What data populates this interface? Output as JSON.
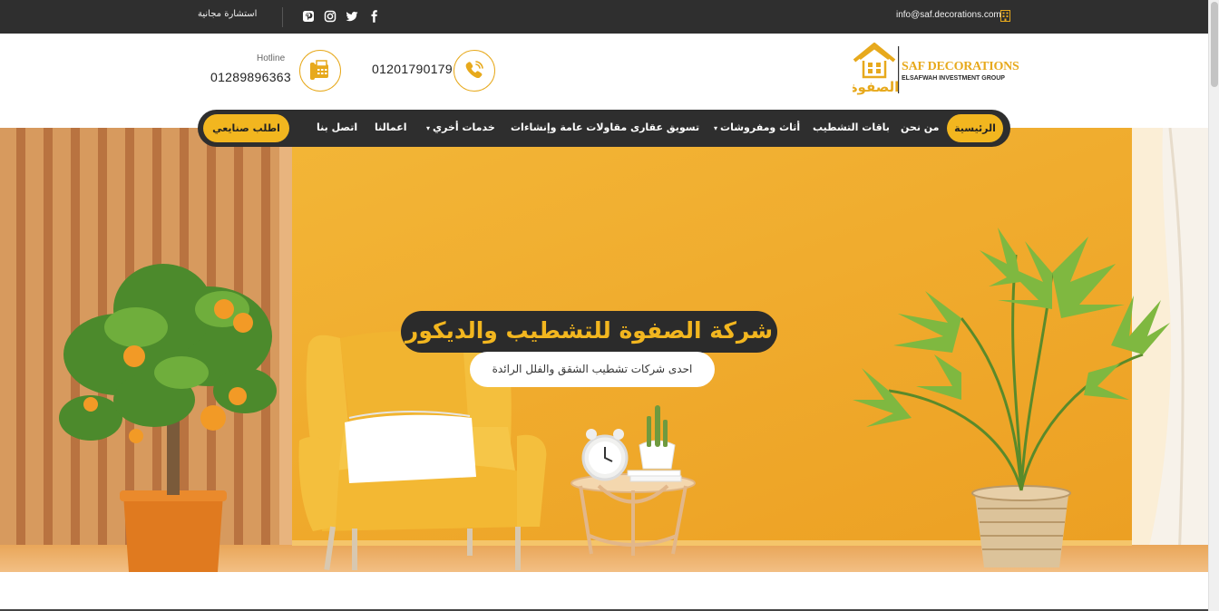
{
  "topbar": {
    "email": "info@saf.decorations.com",
    "consultation": "استشارة مجانية",
    "building_icon": "building-icon",
    "social_icons": [
      "facebook-icon",
      "twitter-icon",
      "instagram-icon",
      "pinterest-icon"
    ]
  },
  "header": {
    "logo_title": "SAF DECORATIONS",
    "logo_subtitle": "ELSAFWAH INVESTMENT GROUP",
    "logo_arabic": "الصفوة",
    "phone": "01201790179",
    "hotline_label": "Hotline",
    "hotline_number": "01289896363"
  },
  "nav": {
    "home": "الرئيسية",
    "about": "من نحن",
    "packages": "باقات التشطيب",
    "furniture": "أثاث ومفروشات",
    "real_estate": "تسويق عقارى",
    "contracting": "مقاولات عامة وإنشاءات",
    "other_services": "خدمات أخري",
    "works": "اعمالنا",
    "contact": "اتصل بنا",
    "cta": "اطلب صنايعي"
  },
  "hero": {
    "title": "شركة الصفوة للتشطيب والديكور",
    "subtitle": "احدى شركات تشطيب الشقق والفلل الرائدة"
  },
  "colors": {
    "accent": "#f2b61f",
    "dark": "#2e2e2e",
    "wall": "#f0b12e"
  }
}
